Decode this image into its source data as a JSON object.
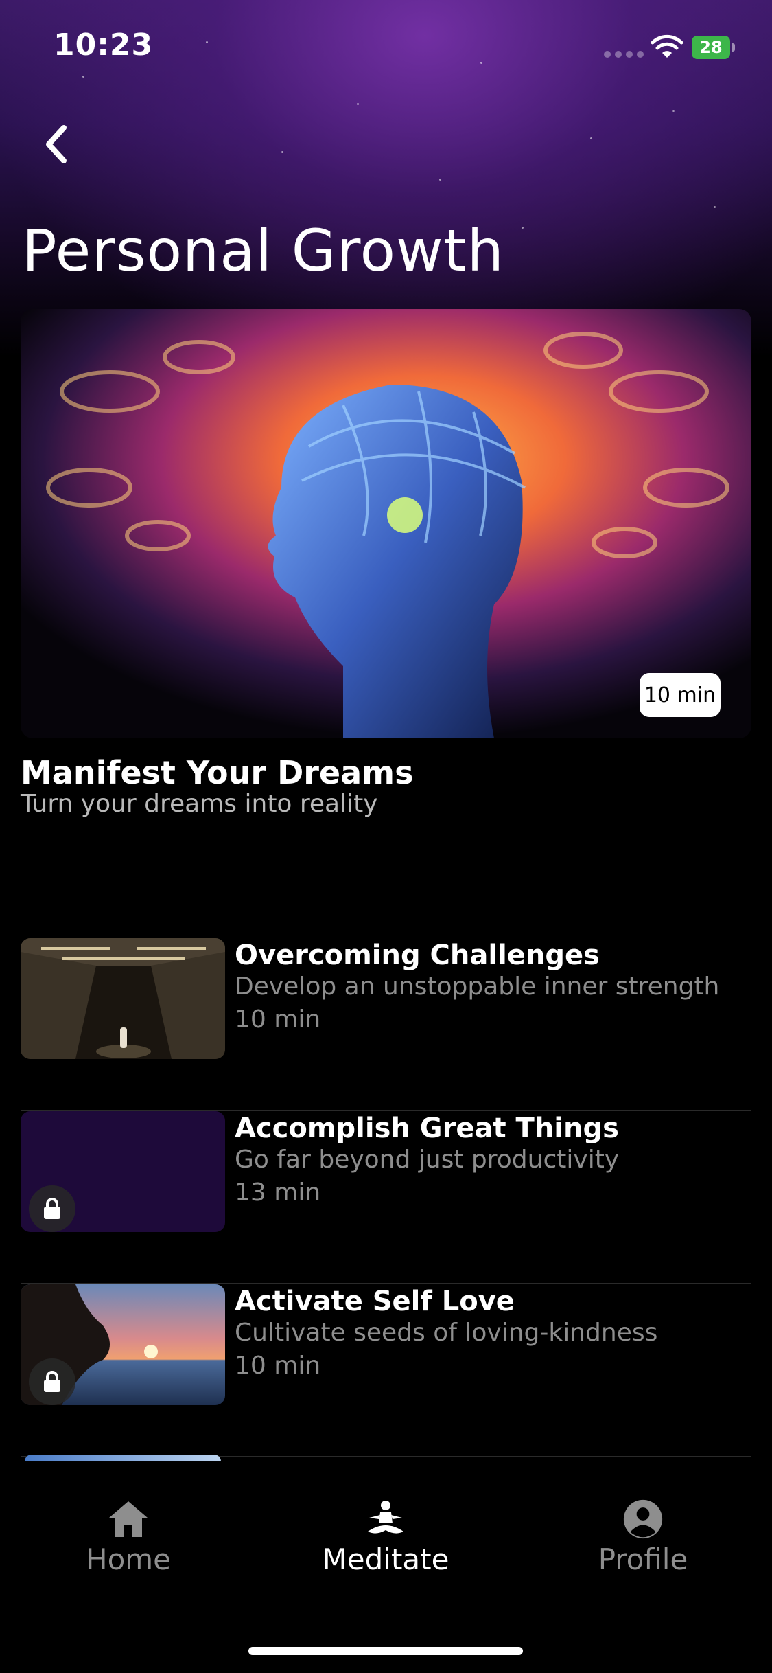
{
  "status_bar": {
    "time": "10:23",
    "battery": "28"
  },
  "header": {
    "title": "Personal Growth",
    "back_icon": "chevron-left-icon"
  },
  "featured": {
    "title": "Manifest Your Dreams",
    "subtitle": "Turn your dreams into reality",
    "duration": "10 min"
  },
  "sessions": [
    {
      "title": "Overcoming Challenges",
      "subtitle": "Develop an unstoppable inner strength",
      "duration": "10 min",
      "locked": false
    },
    {
      "title": "Accomplish Great Things",
      "subtitle": "Go far beyond just productivity",
      "duration": "13 min",
      "locked": true
    },
    {
      "title": "Activate Self Love",
      "subtitle": "Cultivate seeds of loving-kindness",
      "duration": "10 min",
      "locked": true
    }
  ],
  "tab_bar": {
    "tabs": [
      {
        "label": "Home",
        "icon": "home-icon",
        "active": false
      },
      {
        "label": "Meditate",
        "icon": "meditate-icon",
        "active": true
      },
      {
        "label": "Profile",
        "icon": "profile-icon",
        "active": false
      }
    ]
  },
  "colors": {
    "background": "#000000",
    "accent_purple": "#2a1250",
    "muted_text": "#8e8e8e",
    "battery_green": "#3db64a"
  }
}
